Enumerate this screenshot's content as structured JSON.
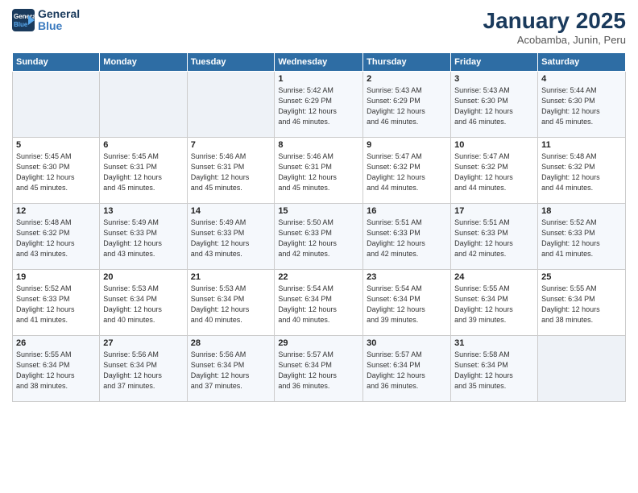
{
  "header": {
    "logo_line1": "General",
    "logo_line2": "Blue",
    "title": "January 2025",
    "subtitle": "Acobamba, Junin, Peru"
  },
  "days_of_week": [
    "Sunday",
    "Monday",
    "Tuesday",
    "Wednesday",
    "Thursday",
    "Friday",
    "Saturday"
  ],
  "weeks": [
    [
      {
        "num": "",
        "info": ""
      },
      {
        "num": "",
        "info": ""
      },
      {
        "num": "",
        "info": ""
      },
      {
        "num": "1",
        "info": "Sunrise: 5:42 AM\nSunset: 6:29 PM\nDaylight: 12 hours\nand 46 minutes."
      },
      {
        "num": "2",
        "info": "Sunrise: 5:43 AM\nSunset: 6:29 PM\nDaylight: 12 hours\nand 46 minutes."
      },
      {
        "num": "3",
        "info": "Sunrise: 5:43 AM\nSunset: 6:30 PM\nDaylight: 12 hours\nand 46 minutes."
      },
      {
        "num": "4",
        "info": "Sunrise: 5:44 AM\nSunset: 6:30 PM\nDaylight: 12 hours\nand 45 minutes."
      }
    ],
    [
      {
        "num": "5",
        "info": "Sunrise: 5:45 AM\nSunset: 6:30 PM\nDaylight: 12 hours\nand 45 minutes."
      },
      {
        "num": "6",
        "info": "Sunrise: 5:45 AM\nSunset: 6:31 PM\nDaylight: 12 hours\nand 45 minutes."
      },
      {
        "num": "7",
        "info": "Sunrise: 5:46 AM\nSunset: 6:31 PM\nDaylight: 12 hours\nand 45 minutes."
      },
      {
        "num": "8",
        "info": "Sunrise: 5:46 AM\nSunset: 6:31 PM\nDaylight: 12 hours\nand 45 minutes."
      },
      {
        "num": "9",
        "info": "Sunrise: 5:47 AM\nSunset: 6:32 PM\nDaylight: 12 hours\nand 44 minutes."
      },
      {
        "num": "10",
        "info": "Sunrise: 5:47 AM\nSunset: 6:32 PM\nDaylight: 12 hours\nand 44 minutes."
      },
      {
        "num": "11",
        "info": "Sunrise: 5:48 AM\nSunset: 6:32 PM\nDaylight: 12 hours\nand 44 minutes."
      }
    ],
    [
      {
        "num": "12",
        "info": "Sunrise: 5:48 AM\nSunset: 6:32 PM\nDaylight: 12 hours\nand 43 minutes."
      },
      {
        "num": "13",
        "info": "Sunrise: 5:49 AM\nSunset: 6:33 PM\nDaylight: 12 hours\nand 43 minutes."
      },
      {
        "num": "14",
        "info": "Sunrise: 5:49 AM\nSunset: 6:33 PM\nDaylight: 12 hours\nand 43 minutes."
      },
      {
        "num": "15",
        "info": "Sunrise: 5:50 AM\nSunset: 6:33 PM\nDaylight: 12 hours\nand 42 minutes."
      },
      {
        "num": "16",
        "info": "Sunrise: 5:51 AM\nSunset: 6:33 PM\nDaylight: 12 hours\nand 42 minutes."
      },
      {
        "num": "17",
        "info": "Sunrise: 5:51 AM\nSunset: 6:33 PM\nDaylight: 12 hours\nand 42 minutes."
      },
      {
        "num": "18",
        "info": "Sunrise: 5:52 AM\nSunset: 6:33 PM\nDaylight: 12 hours\nand 41 minutes."
      }
    ],
    [
      {
        "num": "19",
        "info": "Sunrise: 5:52 AM\nSunset: 6:33 PM\nDaylight: 12 hours\nand 41 minutes."
      },
      {
        "num": "20",
        "info": "Sunrise: 5:53 AM\nSunset: 6:34 PM\nDaylight: 12 hours\nand 40 minutes."
      },
      {
        "num": "21",
        "info": "Sunrise: 5:53 AM\nSunset: 6:34 PM\nDaylight: 12 hours\nand 40 minutes."
      },
      {
        "num": "22",
        "info": "Sunrise: 5:54 AM\nSunset: 6:34 PM\nDaylight: 12 hours\nand 40 minutes."
      },
      {
        "num": "23",
        "info": "Sunrise: 5:54 AM\nSunset: 6:34 PM\nDaylight: 12 hours\nand 39 minutes."
      },
      {
        "num": "24",
        "info": "Sunrise: 5:55 AM\nSunset: 6:34 PM\nDaylight: 12 hours\nand 39 minutes."
      },
      {
        "num": "25",
        "info": "Sunrise: 5:55 AM\nSunset: 6:34 PM\nDaylight: 12 hours\nand 38 minutes."
      }
    ],
    [
      {
        "num": "26",
        "info": "Sunrise: 5:55 AM\nSunset: 6:34 PM\nDaylight: 12 hours\nand 38 minutes."
      },
      {
        "num": "27",
        "info": "Sunrise: 5:56 AM\nSunset: 6:34 PM\nDaylight: 12 hours\nand 37 minutes."
      },
      {
        "num": "28",
        "info": "Sunrise: 5:56 AM\nSunset: 6:34 PM\nDaylight: 12 hours\nand 37 minutes."
      },
      {
        "num": "29",
        "info": "Sunrise: 5:57 AM\nSunset: 6:34 PM\nDaylight: 12 hours\nand 36 minutes."
      },
      {
        "num": "30",
        "info": "Sunrise: 5:57 AM\nSunset: 6:34 PM\nDaylight: 12 hours\nand 36 minutes."
      },
      {
        "num": "31",
        "info": "Sunrise: 5:58 AM\nSunset: 6:34 PM\nDaylight: 12 hours\nand 35 minutes."
      },
      {
        "num": "",
        "info": ""
      }
    ]
  ]
}
